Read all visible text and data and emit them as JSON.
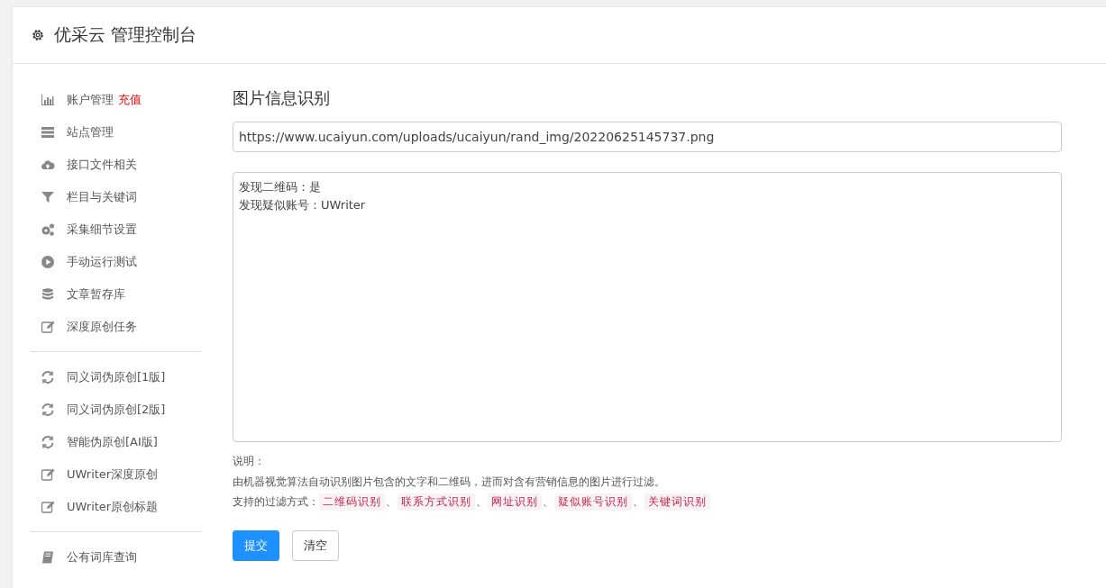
{
  "header": {
    "title": "优采云 管理控制台"
  },
  "sidebar": {
    "groups": [
      {
        "items": [
          {
            "label": "账户管理",
            "kind": "chart",
            "extra": "充值"
          },
          {
            "label": "站点管理",
            "kind": "server"
          },
          {
            "label": "接口文件相关",
            "kind": "cloud"
          },
          {
            "label": "栏目与关键词",
            "kind": "filter"
          },
          {
            "label": "采集细节设置",
            "kind": "gears"
          },
          {
            "label": "手动运行测试",
            "kind": "play"
          },
          {
            "label": "文章暂存库",
            "kind": "database"
          },
          {
            "label": "深度原创任务",
            "kind": "edit"
          }
        ]
      },
      {
        "items": [
          {
            "label": "同义词伪原创[1版]",
            "kind": "refresh"
          },
          {
            "label": "同义词伪原创[2版]",
            "kind": "refresh"
          },
          {
            "label": "智能伪原创[AI版]",
            "kind": "refresh"
          },
          {
            "label": "UWriter深度原创",
            "kind": "edit"
          },
          {
            "label": "UWriter原创标题",
            "kind": "edit"
          }
        ]
      },
      {
        "items": [
          {
            "label": "公有词库查询",
            "kind": "book"
          }
        ]
      }
    ]
  },
  "main": {
    "title": "图片信息识别",
    "url_field": {
      "value": "https://www.ucaiyun.com/uploads/ucaiyun/rand_img/20220625145737.png"
    },
    "result": {
      "lines": [
        "发现二维码：是",
        "发现疑似账号：UWriter"
      ]
    },
    "notes": {
      "heading": "说明：",
      "description": "由机器视觉算法自动识别图片包含的文字和二维码，进而对含有营销信息的图片进行过滤。",
      "filters_label": "支持的过滤方式：",
      "filters": [
        {
          "label": "二维码识别",
          "separator": "、"
        },
        {
          "label": "联系方式识别",
          "separator": "、"
        },
        {
          "label": "网址识别",
          "separator": "、"
        },
        {
          "label": "疑似账号识别",
          "separator": "、"
        },
        {
          "label": "关键词识别"
        }
      ]
    },
    "buttons": [
      {
        "label": "提交",
        "kind": "primary"
      },
      {
        "label": "清空",
        "kind": "default"
      }
    ]
  }
}
